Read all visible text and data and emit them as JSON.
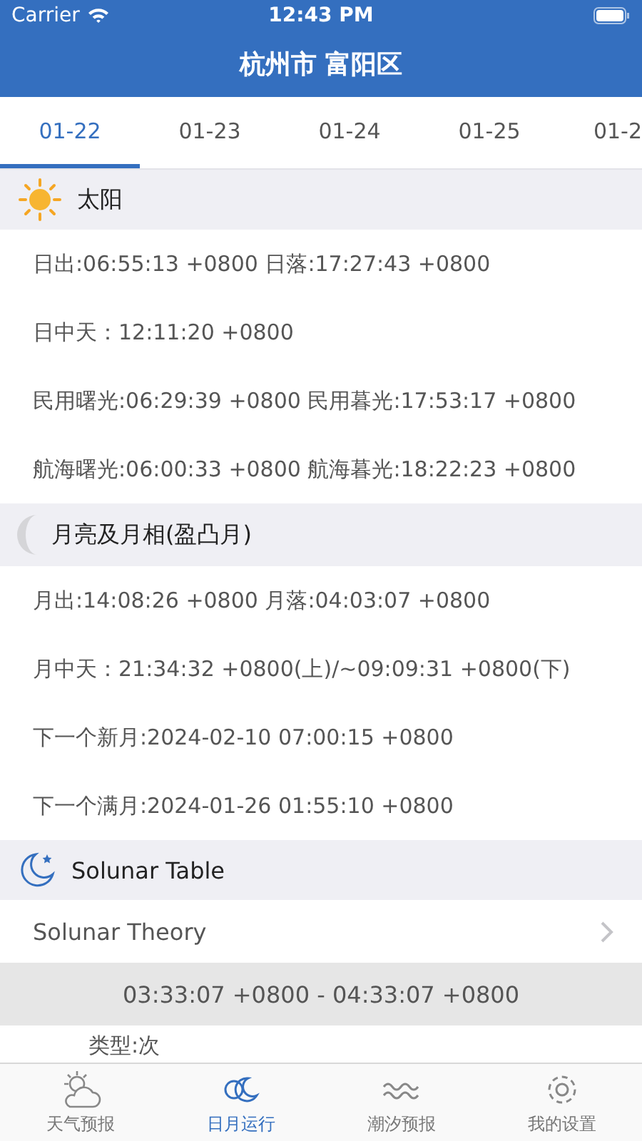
{
  "status_bar": {
    "carrier": "Carrier",
    "time": "12:43 PM"
  },
  "nav": {
    "title": "杭州市 富阳区"
  },
  "date_tabs": [
    {
      "label": "01-22",
      "selected": true
    },
    {
      "label": "01-23",
      "selected": false
    },
    {
      "label": "01-24",
      "selected": false
    },
    {
      "label": "01-25",
      "selected": false
    },
    {
      "label": "01-2",
      "selected": false
    }
  ],
  "sections": [
    {
      "kind": "sun",
      "title": "太阳",
      "rows": [
        {
          "kind": "text",
          "text": "日出:06:55:13 +0800  日落:17:27:43 +0800"
        },
        {
          "kind": "text",
          "text": "日中天：12:11:20 +0800"
        },
        {
          "kind": "text",
          "text": "民用曙光:06:29:39 +0800 民用暮光:17:53:17 +0800"
        },
        {
          "kind": "text",
          "text": "航海曙光:06:00:33 +0800 航海暮光:18:22:23 +0800"
        }
      ]
    },
    {
      "kind": "moon",
      "title": "月亮及月相(盈凸月)",
      "rows": [
        {
          "kind": "text",
          "text": "月出:14:08:26 +0800 月落:04:03:07 +0800"
        },
        {
          "kind": "text",
          "text": "月中天：21:34:32 +0800(上)/~09:09:31 +0800(下)"
        },
        {
          "kind": "text",
          "text": "下一个新月:2024-02-10 07:00:15 +0800"
        },
        {
          "kind": "text",
          "text": "下一个满月:2024-01-26 01:55:10 +0800"
        }
      ]
    },
    {
      "kind": "solunar",
      "title": "Solunar Table",
      "rows": [
        {
          "kind": "link",
          "text": "Solunar Theory"
        },
        {
          "kind": "period",
          "text": "03:33:07 +0800 - 04:33:07 +0800"
        },
        {
          "kind": "note",
          "text": "类型:次"
        }
      ]
    }
  ],
  "tab_bar": [
    {
      "kind": "weather",
      "label": "天气预报",
      "selected": false
    },
    {
      "kind": "sunmoon",
      "label": "日月运行",
      "selected": true
    },
    {
      "kind": "tide",
      "label": "潮汐预报",
      "selected": false
    },
    {
      "kind": "settings",
      "label": "我的设置",
      "selected": false
    }
  ]
}
